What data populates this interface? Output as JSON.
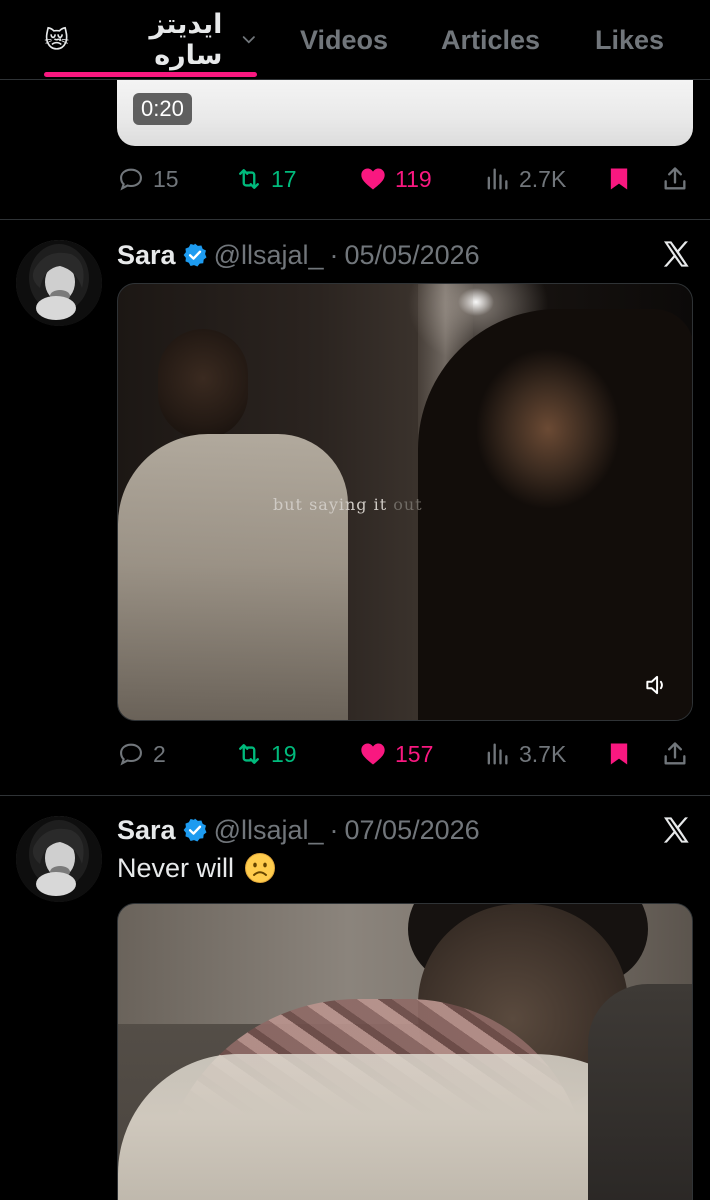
{
  "tabs": {
    "highlights": {
      "label": "ايديتز ساره",
      "emoji": "😿"
    },
    "videos": {
      "label": "Videos"
    },
    "articles": {
      "label": "Articles"
    },
    "likes": {
      "label": "Likes"
    }
  },
  "posts": [
    {
      "media_duration": "0:20",
      "stats": {
        "replies": "15",
        "retweets": "17",
        "likes": "119",
        "views": "2.7K"
      }
    },
    {
      "name": "Sara",
      "handle": "@llsajal_",
      "date": "05/05/2026",
      "dot": "·",
      "media_caption": "but saying it",
      "media_caption_fade": " out",
      "stats": {
        "replies": "2",
        "retweets": "19",
        "likes": "157",
        "views": "3.7K"
      }
    },
    {
      "name": "Sara",
      "handle": "@llsajal_",
      "date": "07/05/2026",
      "dot": "·",
      "text": "Never will"
    }
  ],
  "icons": {
    "reply": "reply-icon",
    "retweet": "retweet-icon",
    "like": "heart-icon",
    "views": "views-icon",
    "bookmark": "bookmark-icon",
    "share": "share-icon",
    "verified": "verified-badge-icon",
    "x": "x-logo-icon",
    "sound": "speaker-icon"
  },
  "colors": {
    "accent_pink": "#f91880",
    "retweet_green": "#00ba7c",
    "muted": "#71767b",
    "verified_blue": "#1d9bf0"
  }
}
